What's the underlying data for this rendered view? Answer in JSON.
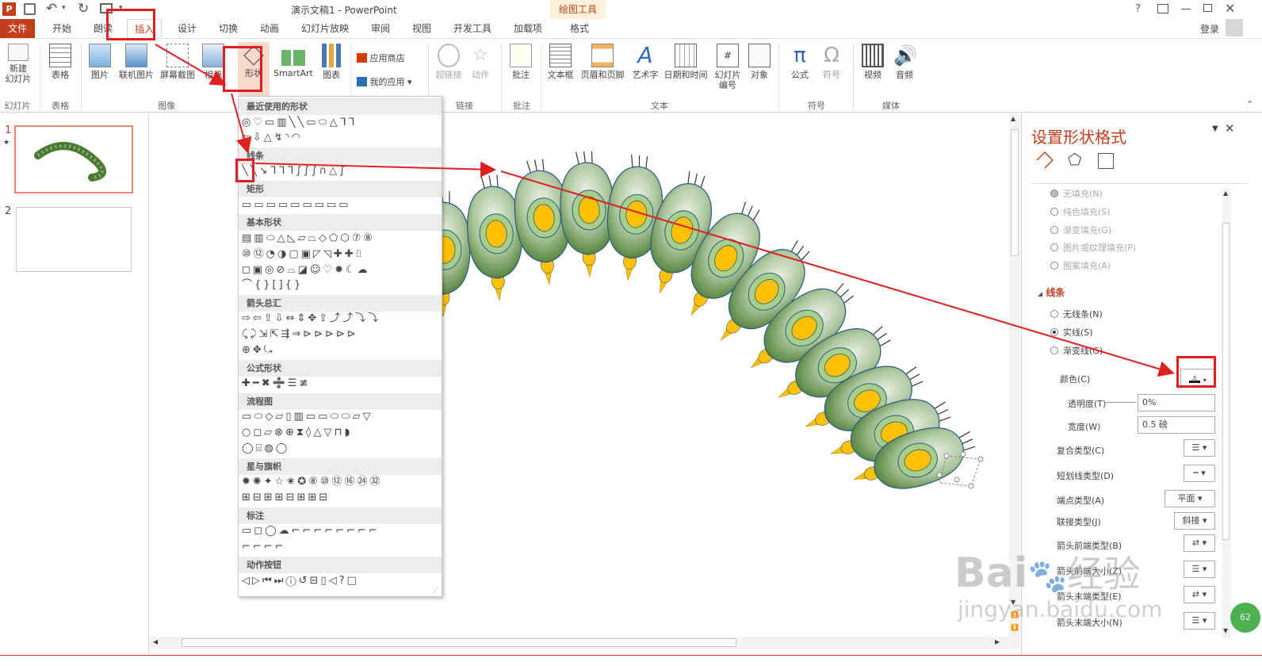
{
  "window": {
    "title": "演示文稿1 - PowerPoint",
    "context_tab": "绘图工具",
    "help": "?",
    "login": "登录"
  },
  "tabs": [
    "文件",
    "开始",
    "朗读",
    "插入",
    "设计",
    "切换",
    "动画",
    "幻灯片放映",
    "审阅",
    "视图",
    "开发工具",
    "加载项",
    "格式"
  ],
  "ribbon": {
    "new_slide": "新建\n幻灯片",
    "table": "表格",
    "picture": "图片",
    "online_picture": "联机图片",
    "screenshot": "屏幕截图",
    "album": "相册",
    "shapes": "形状",
    "smartart": "SmartArt",
    "chart": "图表",
    "store": "应用商店",
    "my_apps": "我的应用",
    "hyperlink": "超链接",
    "action": "动作",
    "comment": "批注",
    "textbox": "文本框",
    "header_footer": "页眉和页脚",
    "wordart": "艺术字",
    "datetime": "日期和时间",
    "slide_number": "幻灯片\n编号",
    "object": "对象",
    "equation": "公式",
    "symbol": "符号",
    "video": "视频",
    "audio": "音频",
    "groups": {
      "slides": "幻灯片",
      "tables": "表格",
      "images": "图像",
      "links": "链接",
      "comments": "批注",
      "text": "文本",
      "symbols": "符号",
      "media": "媒体"
    }
  },
  "thumbnails": [
    {
      "num": "1",
      "star": "★"
    },
    {
      "num": "2",
      "star": ""
    }
  ],
  "shapes_menu": {
    "sections": [
      {
        "name": "最近使用的形状",
        "rows": [
          "◎♡▭▥╲╲▭⬭△ᒣᒣ",
          "⇦⇩△↯◝◠"
        ]
      },
      {
        "name": "线条",
        "rows": [
          "╲╲↘ᒣᒣᒣ∫∫∫∩△∫"
        ]
      },
      {
        "name": "矩形",
        "rows": [
          "▭▭▭▭▭▭▭▭▭"
        ]
      },
      {
        "name": "基本形状",
        "rows": [
          "▤▥⬭△◺▱⏢◇⬠⬡⑦⑧",
          "⑩⑫◔◑▢▣◸◹✚✚⌷",
          "◻▣◎⊘⌓◪☺♡✹☾☁",
          "⌒{}[]{}"
        ]
      },
      {
        "name": "箭头总汇",
        "rows": [
          "⇨⇦⇧⇩⇔⇕✥⇪⤴⤴⤵⤵",
          "⤹⤸⇲⇱⇶⇒⊳⊳⊳⊳⊳",
          "⊕✥⤿"
        ]
      },
      {
        "name": "公式形状",
        "rows": [
          "✚━✖➗☰≢"
        ]
      },
      {
        "name": "流程图",
        "rows": [
          "▭⬭◇▱▯▥▭▭⬭⬭▱▽",
          "○◻▱⊗⊕⧗◊△▽⊓◗",
          "◯⌸◍◯"
        ]
      },
      {
        "name": "星与旗帜",
        "rows": [
          "✹✺✦☆✬✪⑧⑩⑫⑯㉔㉜",
          "⊞⊟⊞⊞⊟⊞⊞⊟"
        ]
      },
      {
        "name": "标注",
        "rows": [
          "▭◻◯☁⌐⌐⌐⌐⌐⌐⌐⌐",
          "⌐⌐⌐⌐"
        ]
      },
      {
        "name": "动作按钮",
        "rows": [
          "◁▷⏮⏭ⓘ↺⊟▯◁?□"
        ]
      }
    ]
  },
  "format_panel": {
    "title": "设置形状格式",
    "fill_options": [
      "无填充(N)",
      "纯色填充(S)",
      "渐变填充(G)",
      "图片或纹理填充(P)",
      "图案填充(A)"
    ],
    "line_section": "线条",
    "line_options": [
      "无线条(N)",
      "实线(S)",
      "渐变线(G)"
    ],
    "color_label": "颜色(C)",
    "transparency_label": "透明度(T)",
    "transparency_value": "0%",
    "width_label": "宽度(W)",
    "width_value": "0.5 磅",
    "compound_label": "复合类型(C)",
    "dash_label": "短划线类型(D)",
    "cap_label": "端点类型(A)",
    "cap_value": "平面",
    "join_label": "联接类型(J)",
    "join_value": "斜接",
    "arrow_begin_type": "箭头前端类型(B)",
    "arrow_begin_size": "箭头前端大小(Z)",
    "arrow_end_type": "箭头末端类型(E)",
    "arrow_end_size": "箭头末端大小(N)"
  },
  "watermark": {
    "brand": "Bai",
    "brand_suffix": "经验",
    "url": "jingyan.baidu.com"
  },
  "colors": {
    "accent": "#c43e1c",
    "segment_dark": "#4a7a2c",
    "segment_light": "#dfe9d8",
    "spot": "#ffc000",
    "spot_ring": "#a8cf8a",
    "red_mark": "#e02020"
  }
}
